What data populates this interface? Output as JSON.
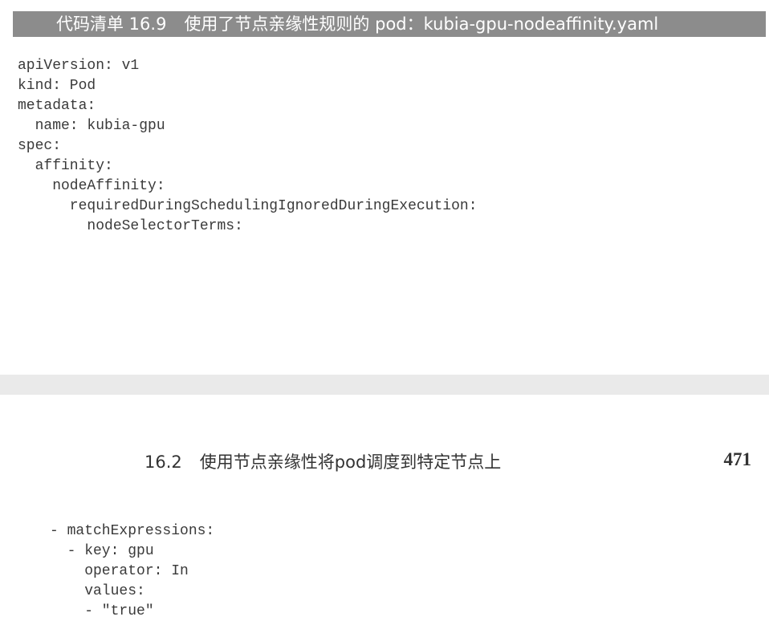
{
  "listing": {
    "number": "代码清单 16.9",
    "title": "使用了节点亲缘性规则的 pod：kubia-gpu-nodeaffinity.yaml"
  },
  "code_top": "apiVersion: v1\nkind: Pod\nmetadata:\n  name: kubia-gpu\nspec:\n  affinity:\n    nodeAffinity:\n      requiredDuringSchedulingIgnoredDuringExecution:\n        nodeSelectorTerms:",
  "running_head": {
    "section_number": "16.2",
    "section_title": "使用节点亲缘性将pod调度到特定节点上"
  },
  "page_number": "471",
  "code_bottom": "- matchExpressions:\n  - key: gpu\n    operator: In\n    values:\n    - \"true\""
}
